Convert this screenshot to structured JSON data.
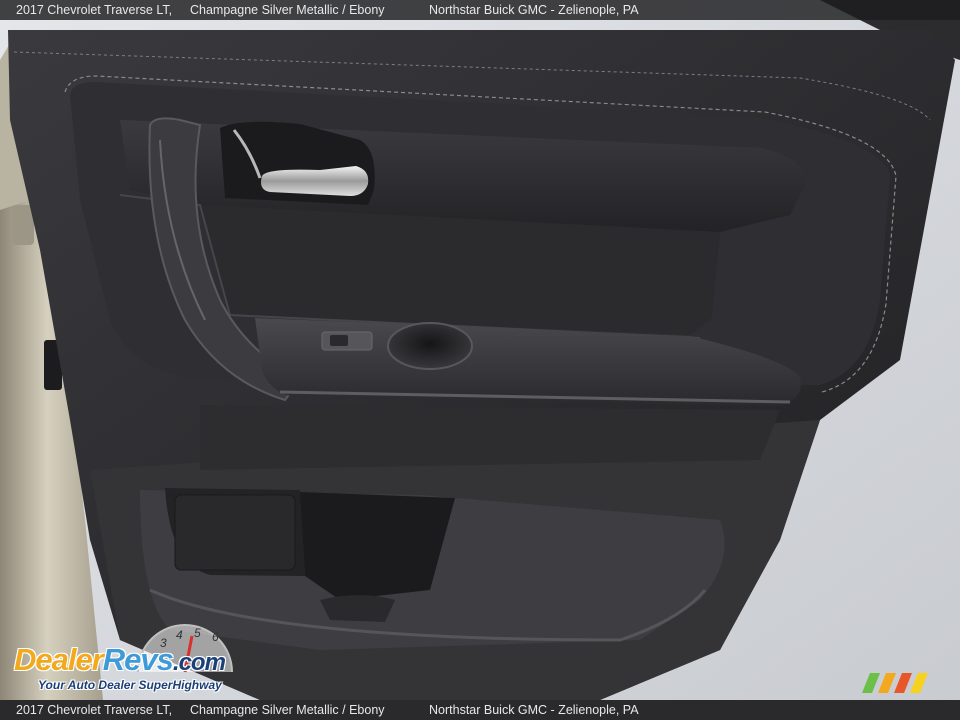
{
  "caption": {
    "model": "2017 Chevrolet Traverse LT,",
    "color": "Champagne Silver Metallic / Ebony",
    "dealer": "Northstar Buick GMC - Zelienople, PA"
  },
  "watermark": {
    "brand_first": "Dealer",
    "brand_second": "Revs",
    "brand_suffix": ".com",
    "tagline": "Your Auto Dealer SuperHighway",
    "gauge_digits": [
      "3",
      "4",
      "5",
      "6"
    ]
  },
  "colors": {
    "leather": "#2a2a2d",
    "stitching": "#8a8a8e",
    "silver_body": "#c9c3b2",
    "brand_orange": "#f2a91e",
    "brand_blue": "#3f9ad8"
  }
}
